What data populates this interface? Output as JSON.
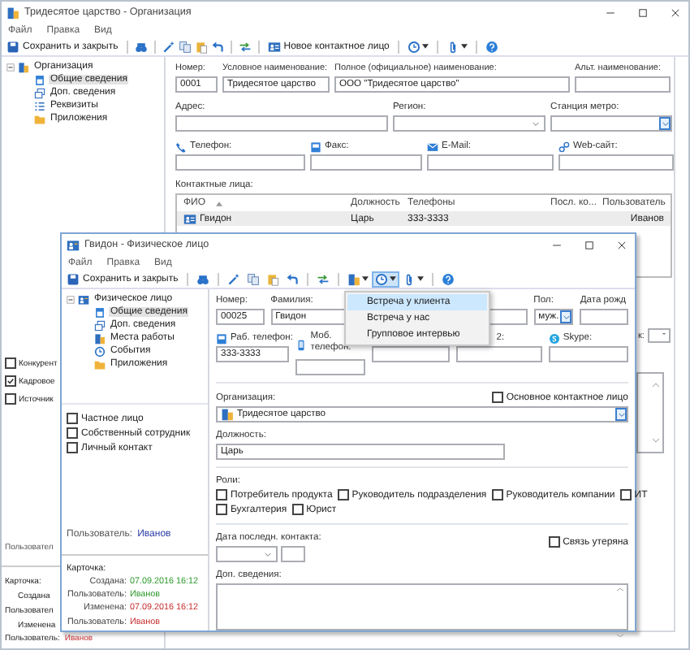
{
  "background_window": {
    "title": "Тридесятое царство - Организация",
    "menu": [
      "Файл",
      "Правка",
      "Вид"
    ],
    "toolbar": {
      "save": "Сохранить и закрыть",
      "new_contact": "Новое контактное лицо"
    },
    "tree": {
      "label": "Организация",
      "expanded": true,
      "children": [
        {
          "label": "Общие сведения",
          "selected": true
        },
        {
          "label": "Доп. сведения",
          "selected": false
        },
        {
          "label": "Реквизиты",
          "selected": false
        },
        {
          "label": "Приложения",
          "selected": false
        }
      ]
    },
    "checkboxes": [
      {
        "label": "Конкурент",
        "checked": false
      },
      {
        "label": "Кадровое",
        "checked": true
      },
      {
        "label": "Источник",
        "checked": false
      }
    ],
    "user_label": "Пользовател",
    "card": {
      "title": "Карточка:",
      "created": "Создана",
      "created_user": "Пользовател",
      "modified": "Изменена",
      "modified_user_label": "Пользователь:",
      "modified_user": "Иванов"
    },
    "fields_row1": [
      {
        "label": "Номер:",
        "value": "0001"
      },
      {
        "label": "Условное наименование:",
        "value": "Тридесятое царство"
      },
      {
        "label": "Полное (официальное) наименование:",
        "value": "ООО \"Тридесятое царство\""
      },
      {
        "label": "Альт. наименование:"
      }
    ],
    "fields_row2": [
      {
        "label": "Адрес:",
        "kind": "text"
      },
      {
        "label": "Регион:",
        "kind": "select"
      },
      {
        "label": "Станция метро:",
        "kind": "combo"
      }
    ],
    "fields_row3": [
      {
        "label": "Телефон:"
      },
      {
        "label": "Факс:"
      },
      {
        "label": "E-Mail:"
      },
      {
        "label": "Web-сайт:"
      }
    ],
    "contacts": {
      "label": "Контактные лица:",
      "columns": [
        "ФИО",
        "Должность",
        "Телефоны",
        "Посл. ко...",
        "Пользователь"
      ],
      "rows": [
        {
          "name": "Гвидон",
          "position": "Царь",
          "phones": "333-3333",
          "user": "Иванов",
          "selected": true
        }
      ]
    },
    "side_field": {
      "label": "к:",
      "value": "-"
    }
  },
  "front_window": {
    "title": "Гвидон - Физическое лицо",
    "menu": [
      "Файл",
      "Правка",
      "Вид"
    ],
    "toolbar": {
      "save": "Сохранить и закрыть"
    },
    "tree": {
      "label": "Физическое лицо",
      "expanded": true,
      "children": [
        {
          "label": "Общие сведения",
          "selected": true
        },
        {
          "label": "Доп. сведения",
          "selected": false
        },
        {
          "label": "Места работы",
          "selected": false
        },
        {
          "label": "События",
          "selected": false
        },
        {
          "label": "Приложения",
          "selected": false
        }
      ]
    },
    "checkboxes": [
      {
        "label": "Частное лицо",
        "checked": false
      },
      {
        "label": "Собственный сотрудник",
        "checked": false
      },
      {
        "label": "Личный контакт",
        "checked": false
      }
    ],
    "user": {
      "label": "Пользователь:",
      "value": "Иванов"
    },
    "card": {
      "title": "Карточка:",
      "created_label": "Создана:",
      "created": "07.09.2016 16:12",
      "created_user_label": "Пользователь:",
      "created_user": "Иванов",
      "modified_label": "Изменена:",
      "modified": "07.09.2016 16:12",
      "modified_user_label": "Пользователь:",
      "modified_user": "Иванов"
    },
    "number": {
      "label": "Номер:",
      "value": "00025"
    },
    "surname": {
      "label": "Фамилия:",
      "value": "Гвидон"
    },
    "gender": {
      "label": "Пол:",
      "value": "муж."
    },
    "birth": {
      "label": "Дата рожд"
    },
    "work_phone": {
      "label": "Раб. телефон:",
      "value": "333-3333"
    },
    "mobile_phone": {
      "label": "Моб. телефон:"
    },
    "phone_2": {
      "label": "2:"
    },
    "skype": {
      "label": "Skype:"
    },
    "organization": {
      "label": "Организация:",
      "value": "Тридесятое царство",
      "main_contact": {
        "label": "Основное контактное лицо",
        "checked": false
      }
    },
    "position": {
      "label": "Должность:",
      "value": "Царь"
    },
    "roles": {
      "label": "Роли:",
      "rows": [
        {
          "items": [
            {
              "label": "Потребитель продукта",
              "checked": false
            },
            {
              "label": "Руководитель подразделения",
              "checked": false
            },
            {
              "label": "Руководитель компании",
              "checked": false
            },
            {
              "label": "ИТ",
              "checked": false
            }
          ]
        },
        {
          "items": [
            {
              "label": "Бухгалтерия",
              "checked": false
            },
            {
              "label": "Юрист",
              "checked": false
            }
          ]
        }
      ]
    },
    "last_contact": {
      "label": "Дата последн. контакта:",
      "lost": {
        "label": "Связь утеряна",
        "checked": false
      }
    },
    "notes": {
      "label": "Доп. сведения:"
    }
  },
  "dropdown_menu": [
    {
      "label": "Встреча у клиента",
      "selected": true
    },
    {
      "label": "Встреча у нас",
      "selected": false
    },
    {
      "label": "Групповое интервью",
      "selected": false
    }
  ]
}
